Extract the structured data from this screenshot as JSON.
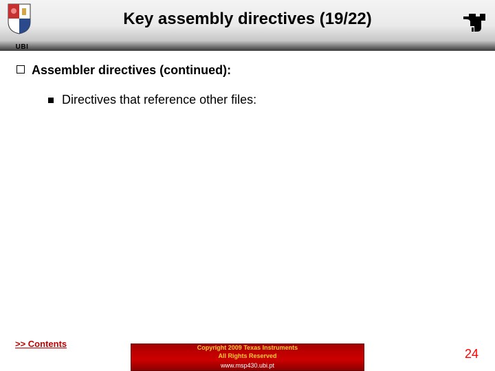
{
  "header": {
    "title": "Key assembly directives (19/22)",
    "ubi_label": "UBI",
    "ti_logo_name": "ti-logo-icon"
  },
  "content": {
    "level1": "Assembler directives (continued):",
    "level2": "Directives that reference other files:"
  },
  "footer": {
    "contents_link": ">> Contents",
    "copyright_line1": "Copyright  2009 Texas Instruments",
    "copyright_line2": "All Rights Reserved",
    "url": "www.msp430.ubi.pt",
    "page_number": "24"
  }
}
